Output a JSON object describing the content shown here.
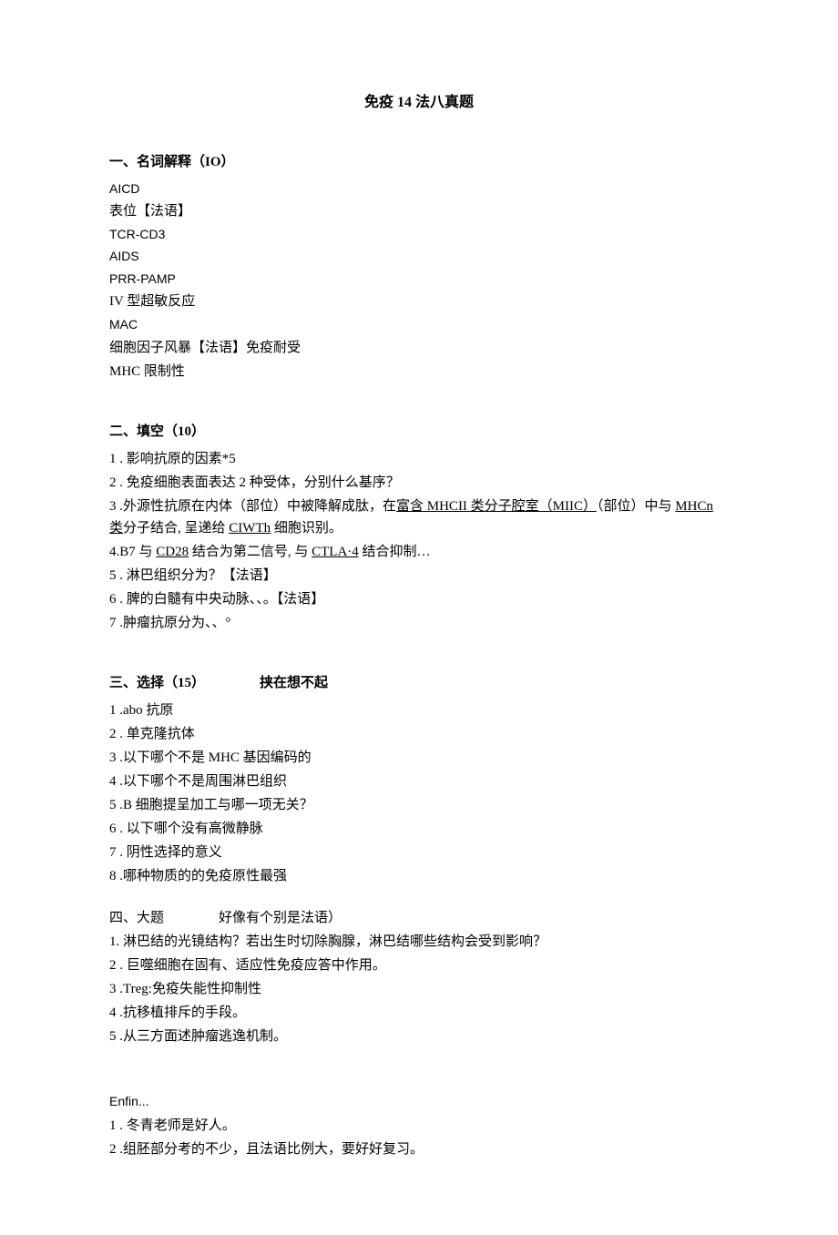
{
  "title": "免疫 14 法八真题",
  "section1": {
    "heading": "一、名词解释（IO）",
    "items": [
      "AICD",
      "表位【法语】",
      "TCR-CD3",
      "AIDS",
      "PRR-PAMP",
      "IV 型超敏反应",
      "MAC",
      "细胞因子风暴【法语】免疫耐受",
      "MHC 限制性"
    ]
  },
  "section2": {
    "heading": "二、填空（10）",
    "item1": "1  . 影响抗原的因素*5",
    "item2": "2  . 免疫细胞表面表达 2 种受体，分别什么基序？",
    "item3_part1": "3  .外源性抗原在内体（部位）中被降解成肽，在",
    "item3_underline1": "富含 MHCII 类分子腔室（MIIC）",
    "item3_part2": "（部位）中与 ",
    "item3_underline2": "MHCn 类",
    "item3_part3": "分子结合, 呈递给 ",
    "item3_underline3": "CIWTh",
    "item3_part4": " 细胞识别。",
    "item4_part1": "4.B7 与 ",
    "item4_underline1": "CD28",
    "item4_part2": " 结合为第二信号, 与 ",
    "item4_underline2": "CTLA·4",
    "item4_part3": " 结合抑制…",
    "item5": "5  . 淋巴组织分为？【法语】",
    "item6": "6  . 脾的白髓有中央动脉、、。【法语】",
    "item7": "7  .肿瘤抗原分为、、°"
  },
  "section3": {
    "heading_left": "三、选择（15）",
    "heading_right": "挟在想不起",
    "items": [
      "1  .abo 抗原",
      "2  . 单克隆抗体",
      "3  .以下哪个不是 MHC 基因编码的",
      "4  .以下哪个不是周围淋巴组织",
      "5  .B 细胞提呈加工与哪一项无关？",
      "6  . 以下哪个没有高微静脉",
      "7  . 阴性选择的意义",
      "8  .哪种物质的的免疫原性最强"
    ]
  },
  "section4": {
    "heading_left": "四、大题",
    "heading_right": "好像有个别是法语）",
    "items": [
      "1. 淋巴结的光镜结构？若出生时切除胸腺，淋巴结哪些结构会受到影响？",
      "2  . 巨噬细胞在固有、适应性免疫应答中作用。",
      "3  .Treg:免疫失能性抑制性",
      "4  .抗移植排斥的手段。",
      "5  .从三方面述肿瘤逃逸机制。"
    ]
  },
  "footer": {
    "note": "Enfin...",
    "items": [
      "1  . 冬青老师是好人。",
      "2  .组胚部分考的不少，且法语比例大，要好好复习。"
    ]
  }
}
